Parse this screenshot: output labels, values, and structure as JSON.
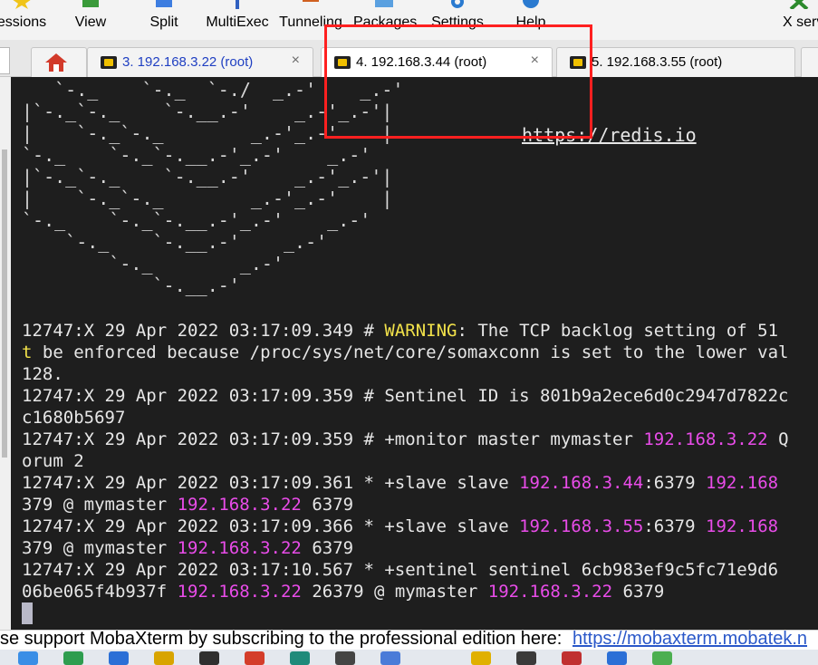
{
  "toolbar": {
    "items": [
      {
        "label": "essions",
        "icon": "sessions-icon"
      },
      {
        "label": "View",
        "icon": "view-icon"
      },
      {
        "label": "Split",
        "icon": "split-icon"
      },
      {
        "label": "MultiExec",
        "icon": "multiexec-icon"
      },
      {
        "label": "Tunneling",
        "icon": "tunneling-icon"
      },
      {
        "label": "Packages",
        "icon": "packages-icon"
      },
      {
        "label": "Settings",
        "icon": "settings-gear-icon"
      },
      {
        "label": "Help",
        "icon": "help-icon"
      },
      {
        "label": "X serv",
        "icon": "x-server-icon"
      }
    ]
  },
  "tabs": [
    {
      "label": "3. 192.168.3.22 (root)",
      "close": "×",
      "active": false
    },
    {
      "label": "4. 192.168.3.44 (root)",
      "close": "×",
      "active": true
    },
    {
      "label": "5. 192.168.3.55 (root)",
      "close": "",
      "active": false
    }
  ],
  "terminal": {
    "ascii_art": [
      "   `-._    `-._  `-./  _.-'    _.-'",
      "|`-._`-._    `-.__.-'    _.-'_.-'|",
      "|    `-._`-._        _.-'_.-'    |",
      "`-._    `-._`-.__.-'_.-'    _.-'",
      "|`-._`-._    `-.__.-'    _.-'_.-'|",
      "|    `-._`-._        _.-'_.-'    |",
      "`-._    `-._`-.__.-'_.-'    _.-'",
      "    `-._    `-.__.-'    _.-'",
      "        `-._        _.-'",
      "            `-.__.-'"
    ],
    "url": "https://redis.io",
    "log_lines": [
      [
        {
          "t": "12747:X 29 Apr 2022 03:17:09.349 # "
        },
        {
          "t": "WARNING",
          "c": "warn"
        },
        {
          "t": ": The TCP backlog setting of 51"
        }
      ],
      [
        {
          "t": "t",
          "c": "warn"
        },
        {
          "t": " be enforced because /proc/sys/net/core/somaxconn is set to the lower val"
        }
      ],
      [
        {
          "t": "128."
        }
      ],
      [
        {
          "t": "12747:X 29 Apr 2022 03:17:09.359 # Sentinel ID is 801b9a2ece6d0c2947d7822c"
        }
      ],
      [
        {
          "t": "c1680b5697"
        }
      ],
      [
        {
          "t": "12747:X 29 Apr 2022 03:17:09.359 # +monitor master mymaster "
        },
        {
          "t": "192.168.3.22",
          "c": "ip"
        },
        {
          "t": " Q"
        }
      ],
      [
        {
          "t": "orum 2"
        }
      ],
      [
        {
          "t": "12747:X 29 Apr 2022 03:17:09.361 * +slave slave "
        },
        {
          "t": "192.168.3.44",
          "c": "ip"
        },
        {
          "t": ":6379 "
        },
        {
          "t": "192.168",
          "c": "ip"
        }
      ],
      [
        {
          "t": "379 @ mymaster "
        },
        {
          "t": "192.168.3.22",
          "c": "ip"
        },
        {
          "t": " 6379"
        }
      ],
      [
        {
          "t": "12747:X 29 Apr 2022 03:17:09.366 * +slave slave "
        },
        {
          "t": "192.168.3.55",
          "c": "ip"
        },
        {
          "t": ":6379 "
        },
        {
          "t": "192.168",
          "c": "ip"
        }
      ],
      [
        {
          "t": "379 @ mymaster "
        },
        {
          "t": "192.168.3.22",
          "c": "ip"
        },
        {
          "t": " 6379"
        }
      ],
      [
        {
          "t": "12747:X 29 Apr 2022 03:17:10.567 * +sentinel sentinel 6cb983ef9c5fc71e9d6"
        }
      ],
      [
        {
          "t": "06be065f4b937f "
        },
        {
          "t": "192.168.3.22",
          "c": "ip"
        },
        {
          "t": " 26379 @ mymaster "
        },
        {
          "t": "192.168.3.22",
          "c": "ip"
        },
        {
          "t": " 6379"
        }
      ]
    ]
  },
  "statusbar": {
    "message": "se support MobaXterm by subscribing to the professional edition here:",
    "link": "https://mobaxterm.mobatek.n"
  },
  "colors": {
    "terminal_bg": "#1e1e1e",
    "ip_magenta": "#e94ce9",
    "warning_yellow": "#f2e24a",
    "highlight_red": "#ff2020"
  }
}
